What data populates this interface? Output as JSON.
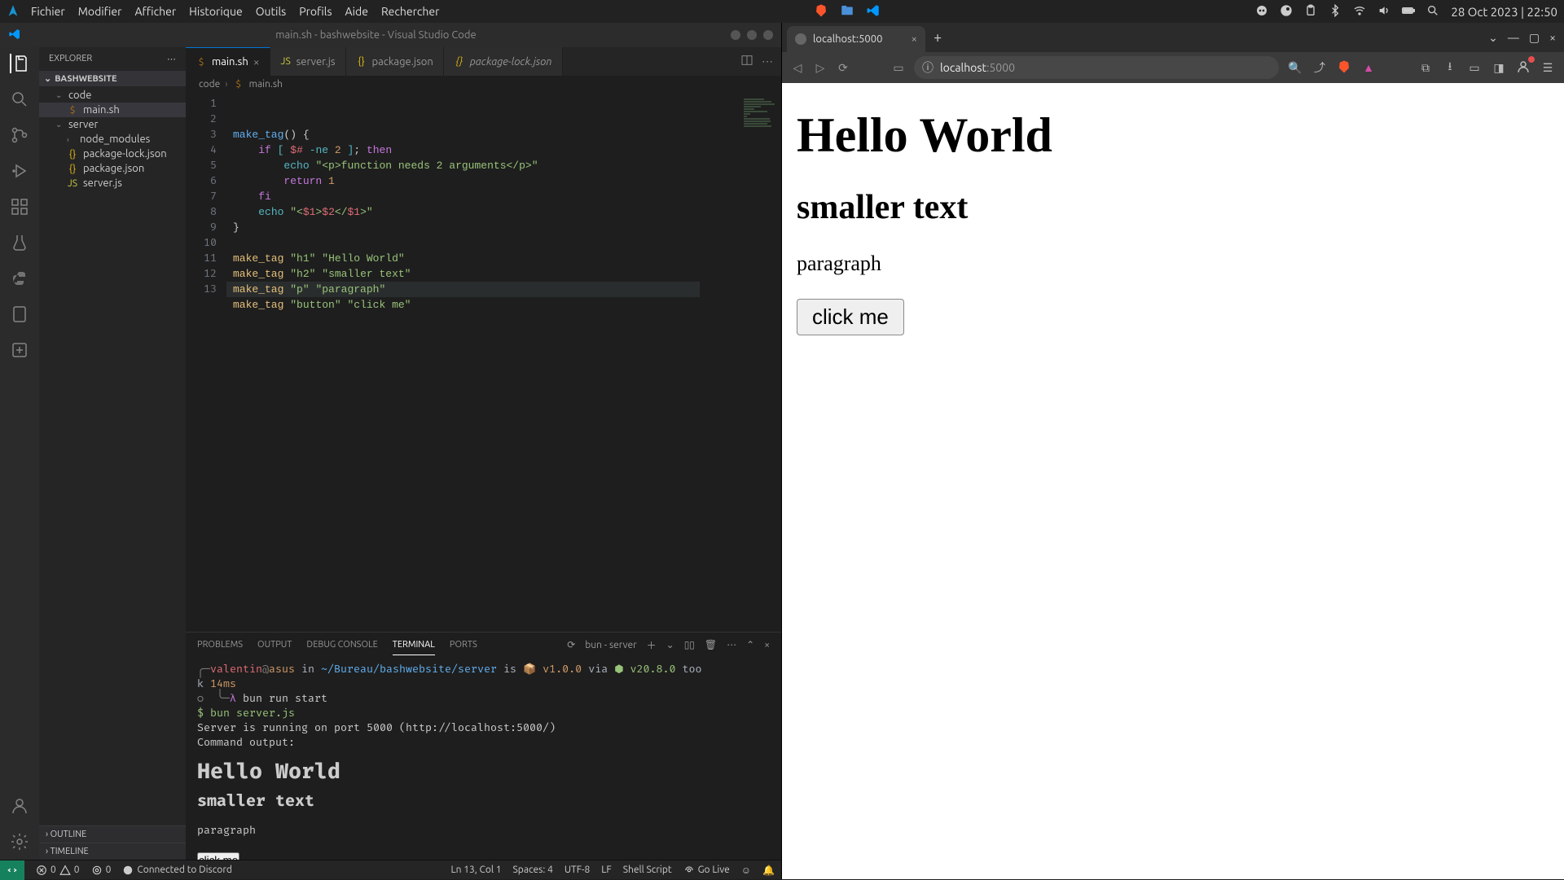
{
  "os": {
    "menus": [
      "Fichier",
      "Modifier",
      "Afficher",
      "Historique",
      "Outils",
      "Profils",
      "Aide",
      "Rechercher"
    ],
    "clock": "28 Oct 2023 | 22:50"
  },
  "vscode": {
    "title": "main.sh - bashwebsite - Visual Studio Code",
    "explorer": {
      "header": "EXPLORER",
      "root": "BASHWEBSITE",
      "tree": [
        {
          "type": "folder",
          "label": "code",
          "expanded": true,
          "depth": 1
        },
        {
          "type": "file",
          "label": "main.sh",
          "icon": "sh",
          "depth": 2,
          "selected": true
        },
        {
          "type": "folder",
          "label": "server",
          "expanded": true,
          "depth": 1
        },
        {
          "type": "folder",
          "label": "node_modules",
          "expanded": false,
          "depth": 2
        },
        {
          "type": "file",
          "label": "package-lock.json",
          "icon": "json",
          "depth": 2
        },
        {
          "type": "file",
          "label": "package.json",
          "icon": "json",
          "depth": 2
        },
        {
          "type": "file",
          "label": "server.js",
          "icon": "js",
          "depth": 2
        }
      ],
      "outline": "OUTLINE",
      "timeline": "TIMELINE"
    },
    "tabs": [
      {
        "label": "main.sh",
        "icon": "sh",
        "active": true,
        "close": true
      },
      {
        "label": "server.js",
        "icon": "js"
      },
      {
        "label": "package.json",
        "icon": "json"
      },
      {
        "label": "package-lock.json",
        "icon": "json",
        "italic": true
      }
    ],
    "breadcrumbs": [
      "code",
      "main.sh"
    ],
    "code_lines": 13,
    "panel": {
      "tabs": [
        "PROBLEMS",
        "OUTPUT",
        "DEBUG CONSOLE",
        "TERMINAL",
        "PORTS"
      ],
      "active": "TERMINAL",
      "task": "bun - server"
    },
    "terminal": {
      "user": "valentin",
      "host": "asus",
      "path": "~/Bureau/bashwebsite/server",
      "is": "is",
      "pkg": "v1.0.0",
      "via": "via",
      "node": "v20.8.0",
      "took": "took 14ms",
      "cmd": "bun run start",
      "sub": "$ bun server.js",
      "lines": [
        "Server is running on port 5000 (http://localhost:5000/)",
        "Command output:",
        " <h1>Hello World</h1>",
        "<h2>smaller text</h2>",
        "<p>paragraph</p>",
        "<button>click me</button>"
      ],
      "cursor": "▯"
    },
    "status": {
      "errors": "0",
      "warnings": "0",
      "ports": "0",
      "discord": "Connected to Discord",
      "pos": "Ln 13, Col 1",
      "spaces": "Spaces: 4",
      "enc": "UTF-8",
      "eol": "LF",
      "lang": "Shell Script",
      "golive": "Go Live"
    }
  },
  "browser": {
    "tab_title": "localhost:5000",
    "url_host": "localhost",
    "url_port": ":5000",
    "page": {
      "h1": "Hello World",
      "h2": "smaller text",
      "p": "paragraph",
      "button": "click me"
    }
  }
}
